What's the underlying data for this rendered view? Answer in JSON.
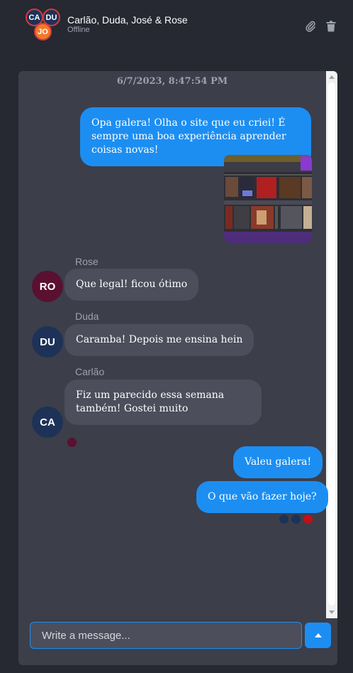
{
  "header": {
    "avatars": [
      {
        "initials": "CA",
        "color": "#1e3258"
      },
      {
        "initials": "DU",
        "color": "#1e3258"
      },
      {
        "initials": "JO",
        "color": "#f07a2a"
      }
    ],
    "title": "Carlão, Duda, José & Rose",
    "status": "Offline",
    "attach_icon": "paperclip-icon",
    "delete_icon": "trash-icon"
  },
  "chat": {
    "timestamp": "6/7/2023, 8:47:54 PM",
    "messages": [
      {
        "sender": "me",
        "text": "Opa galera! Olha o site que eu criei! É sempre uma boa experiência aprender coisas novas!"
      },
      {
        "sender": "me",
        "type": "image"
      },
      {
        "sender": "Rose",
        "initials": "RO",
        "avatar_color": "#5a1030",
        "text": "Que legal! ficou ótimo"
      },
      {
        "sender": "Duda",
        "initials": "DU",
        "avatar_color": "#1e3258",
        "text": "Caramba! Depois me ensina hein"
      },
      {
        "sender": "Carlão",
        "initials": "CA",
        "avatar_color": "#1e3258",
        "text": "Fiz um parecido essa semana também! Gostei muito"
      },
      {
        "sender": "me",
        "text": "Valeu galera!"
      },
      {
        "sender": "me",
        "text": "O que vão fazer hoje?"
      }
    ],
    "read_receipts": {
      "carlao_message": [
        "#5a1030"
      ],
      "last_message": [
        "#1e3258",
        "#1e3258",
        "#c0101a"
      ]
    }
  },
  "composer": {
    "placeholder": "Write a message...",
    "value": "",
    "send_icon": "send-arrow-up-icon"
  },
  "colors": {
    "background": "#262832",
    "panel": "#3c3e4a",
    "bubble_me": "#1c8ef2",
    "bubble_other": "#4c4e5b",
    "muted_text": "#9ea2ad"
  }
}
